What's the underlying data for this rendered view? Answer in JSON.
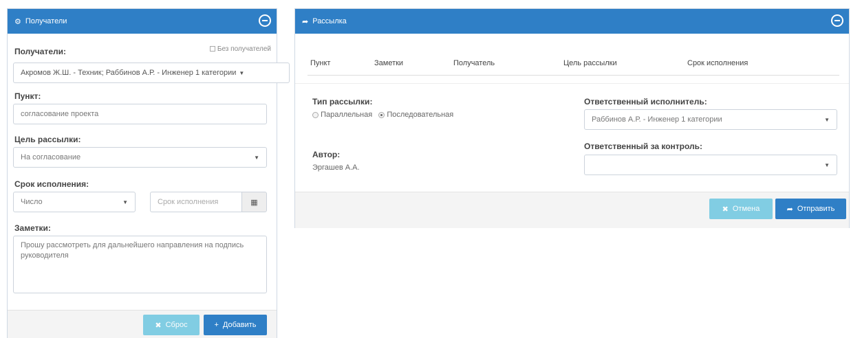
{
  "left": {
    "title": "Получатели",
    "recipients_label": "Получатели:",
    "no_recipients_label": "Без получателей",
    "recipients_value": "Акромов Ж.Ш. - Техник; Раббинов А.Р. - Инженер 1 категории",
    "punkt_label": "Пункт:",
    "punkt_value": "согласование проекта",
    "purpose_label": "Цель рассылки:",
    "purpose_value": "На согласование",
    "deadline_label": "Срок исполнения:",
    "deadline_type_value": "Число",
    "deadline_placeholder": "Срок исполнения",
    "notes_label": "Заметки:",
    "notes_value": "Прошу рассмотреть для дальнейшего направления на подпись руководителя",
    "reset_label": "Сброс",
    "add_label": "Добавить"
  },
  "right": {
    "title": "Рассылка",
    "columns": [
      "Пункт",
      "Заметки",
      "Получатель",
      "Цель рассылки",
      "Срок исполнения"
    ],
    "type_label": "Тип рассылки:",
    "type_options": [
      "Параллельная",
      "Последовательная"
    ],
    "type_selected": "Последовательная",
    "author_label": "Автор:",
    "author_value": "Эргашев А.А.",
    "responsible_label": "Ответственный исполнитель:",
    "responsible_value": "Раббинов А.Р. - Инженер 1 категории",
    "control_label": "Ответственный за контроль:",
    "control_value": "",
    "cancel_label": "Отмена",
    "send_label": "Отправить"
  },
  "colors": {
    "header": "#2f7fc6",
    "button_light": "#5bc0de",
    "button_primary": "#2f7fc6"
  },
  "icons": [
    "gear-icon",
    "share-icon",
    "minus-circle-icon",
    "calendar-icon",
    "close-icon",
    "plus-icon",
    "chevron-down-icon"
  ]
}
